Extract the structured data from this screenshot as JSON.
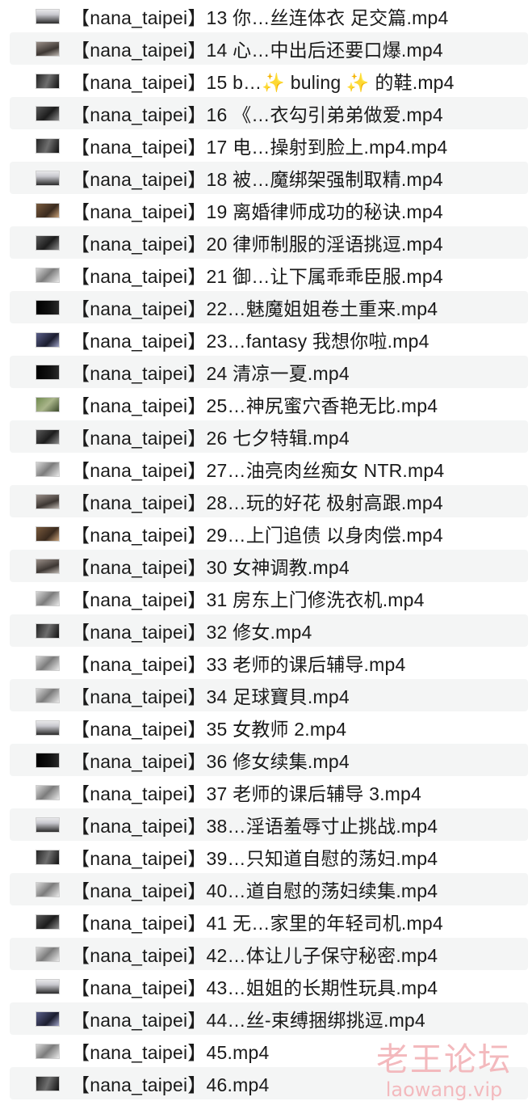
{
  "files": [
    {
      "name": "【nana_taipei】13 你…丝连体衣 足交篇.mp4"
    },
    {
      "name": "【nana_taipei】14 心…中出后还要口爆.mp4"
    },
    {
      "name": "【nana_taipei】15 b…✨ buling ✨ 的鞋.mp4"
    },
    {
      "name": "【nana_taipei】16 《…衣勾引弟弟做爱.mp4"
    },
    {
      "name": "【nana_taipei】17 电…操射到脸上.mp4.mp4"
    },
    {
      "name": "【nana_taipei】18 被…魔绑架强制取精.mp4"
    },
    {
      "name": "【nana_taipei】19 离婚律师成功的秘诀.mp4"
    },
    {
      "name": "【nana_taipei】20 律师制服的淫语挑逗.mp4"
    },
    {
      "name": "【nana_taipei】21 御…让下属乖乖臣服.mp4"
    },
    {
      "name": "【nana_taipei】22…魅魔姐姐卷土重来.mp4"
    },
    {
      "name": "【nana_taipei】23…fantasy 我想你啦.mp4"
    },
    {
      "name": "【nana_taipei】24 清凉一夏.mp4"
    },
    {
      "name": "【nana_taipei】25…神尻蜜穴香艳无比.mp4"
    },
    {
      "name": "【nana_taipei】26 七夕特辑.mp4"
    },
    {
      "name": "【nana_taipei】27…油亮肉丝痴女 NTR.mp4"
    },
    {
      "name": "【nana_taipei】28…玩的好花 极射高跟.mp4"
    },
    {
      "name": "【nana_taipei】29…上门追债 以身肉偿.mp4"
    },
    {
      "name": "【nana_taipei】30 女神调教.mp4"
    },
    {
      "name": "【nana_taipei】31 房东上门修洗衣机.mp4"
    },
    {
      "name": "【nana_taipei】32 修女.mp4"
    },
    {
      "name": "【nana_taipei】33 老师的课后辅导.mp4"
    },
    {
      "name": "【nana_taipei】34 足球寶貝.mp4"
    },
    {
      "name": "【nana_taipei】35 女教师 2.mp4"
    },
    {
      "name": "【nana_taipei】36 修女续集.mp4"
    },
    {
      "name": "【nana_taipei】37 老师的课后辅导 3.mp4"
    },
    {
      "name": "【nana_taipei】38…淫语羞辱寸止挑战.mp4"
    },
    {
      "name": "【nana_taipei】39…只知道自慰的荡妇.mp4"
    },
    {
      "name": "【nana_taipei】40…道自慰的荡妇续集.mp4"
    },
    {
      "name": "【nana_taipei】41 无…家里的年轻司机.mp4"
    },
    {
      "name": "【nana_taipei】42…体让儿子保守秘密.mp4"
    },
    {
      "name": "【nana_taipei】43…姐姐的长期性玩具.mp4"
    },
    {
      "name": "【nana_taipei】44…丝-束缚捆绑挑逗.mp4"
    },
    {
      "name": "【nana_taipei】45.mp4"
    },
    {
      "name": "【nana_taipei】46.mp4"
    }
  ],
  "watermark": {
    "title": "老王论坛",
    "url": "laowang.vip"
  }
}
